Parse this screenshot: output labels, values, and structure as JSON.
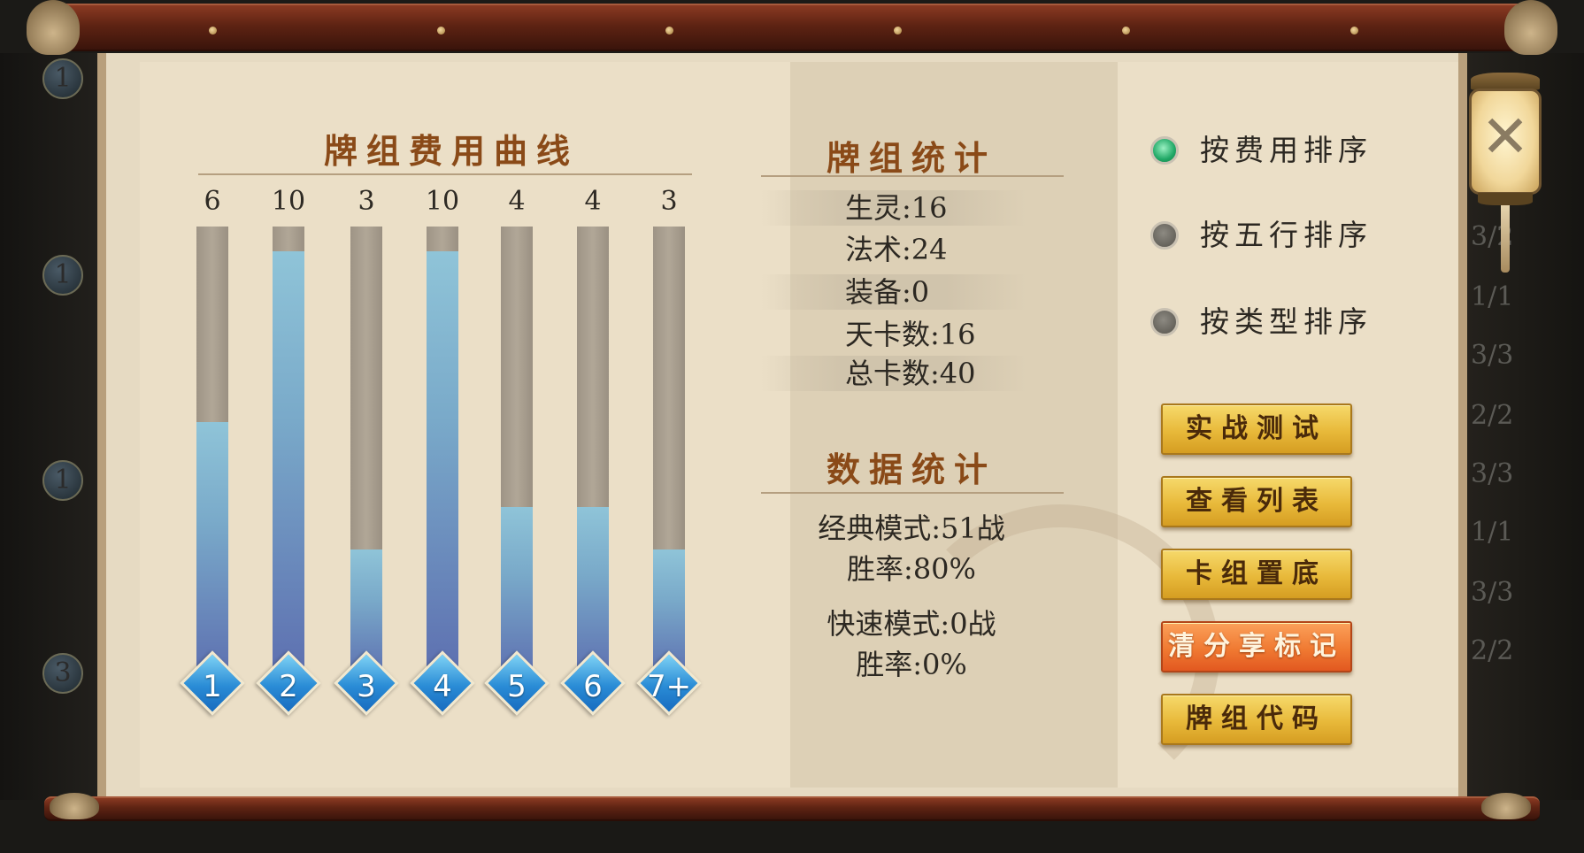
{
  "cost_curve": {
    "title": "牌组费用曲线",
    "columns": [
      {
        "label": "1",
        "count": "6",
        "fill": 0.6
      },
      {
        "label": "2",
        "count": "10",
        "fill": 1.0
      },
      {
        "label": "3",
        "count": "3",
        "fill": 0.3
      },
      {
        "label": "4",
        "count": "10",
        "fill": 1.0
      },
      {
        "label": "5",
        "count": "4",
        "fill": 0.4
      },
      {
        "label": "6",
        "count": "4",
        "fill": 0.4
      },
      {
        "label": "7+",
        "count": "3",
        "fill": 0.3
      }
    ]
  },
  "deck_stats": {
    "title": "牌组统计",
    "rows": [
      "生灵:16",
      "法术:24",
      "装备:0",
      "天卡数:16",
      "总卡数:40"
    ]
  },
  "data_stats": {
    "title": "数据统计",
    "classic": "经典模式:51战",
    "classic_rate": "胜率:80%",
    "quick": "快速模式:0战",
    "quick_rate": "胜率:0%"
  },
  "sort_options": [
    {
      "label": "按费用排序",
      "selected": true
    },
    {
      "label": "按五行排序",
      "selected": false
    },
    {
      "label": "按类型排序",
      "selected": false
    }
  ],
  "actions": {
    "test": "实战测试",
    "view_list": "查看列表",
    "sink_deck": "卡组置底",
    "clear_share": "清分享标记",
    "deck_code": "牌组代码"
  },
  "close": {
    "glyph": "✕"
  },
  "background": {
    "left_badges": [
      "1",
      "1",
      "1",
      "3"
    ],
    "right_counts": [
      "3/2",
      "1/1",
      "3/3",
      "2/2",
      "3/3",
      "1/1",
      "3/3",
      "2/2"
    ]
  }
}
